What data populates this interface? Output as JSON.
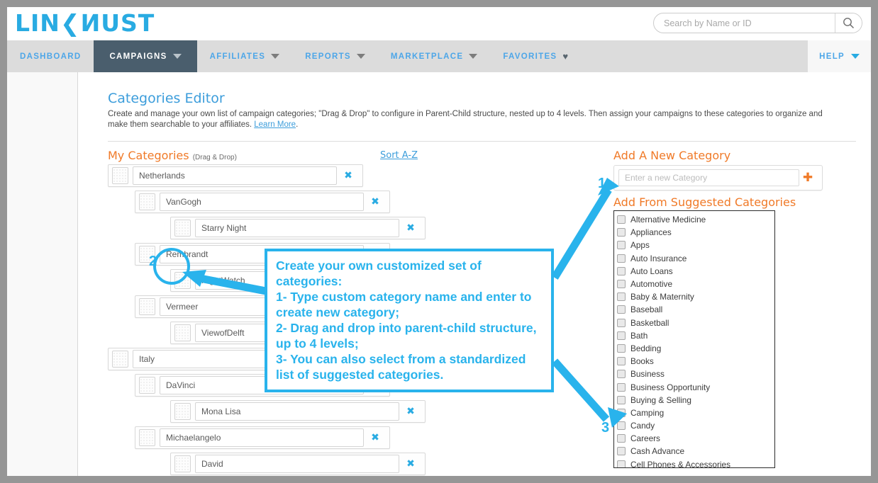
{
  "brand": {
    "logo_part1": "LIN",
    "logo_k": "❮",
    "logo_part2": "ИUSТ",
    "logo_text": "LINKTRUST"
  },
  "search": {
    "placeholder": "Search by Name or ID",
    "value": "",
    "icon": "search-icon"
  },
  "nav": {
    "items": [
      {
        "label": "DASHBOARD",
        "has_caret": false,
        "active": false
      },
      {
        "label": "CAMPAIGNS",
        "has_caret": true,
        "active": true
      },
      {
        "label": "AFFILIATES",
        "has_caret": true,
        "active": false
      },
      {
        "label": "REPORTS",
        "has_caret": true,
        "active": false
      },
      {
        "label": "MARKETPLACE",
        "has_caret": true,
        "active": false
      },
      {
        "label": "FAVORITES",
        "has_caret": false,
        "active": false,
        "icon": "heart-icon"
      }
    ],
    "help_label": "HELP"
  },
  "page": {
    "title": "Categories Editor",
    "description_before_link": "Create and manage your own list of campaign categories; \"Drag & Drop\" to configure in Parent-Child structure, nested up to 4 levels. Then assign your campaigns to these categories to organize and make them searchable to your affiliates. ",
    "link_text": "Learn More",
    "description_after_link": "."
  },
  "my_categories": {
    "heading": "My Categories",
    "heading_hint": "(Drag & Drop)",
    "sort_link": "Sort A-Z",
    "items": [
      {
        "name": "Netherlands",
        "level": 0
      },
      {
        "name": "VanGogh",
        "level": 1
      },
      {
        "name": "Starry Night",
        "level": 2
      },
      {
        "name": "Rembrandt",
        "level": 1
      },
      {
        "name": "NightWatch",
        "level": 2
      },
      {
        "name": "Vermeer",
        "level": 1
      },
      {
        "name": "ViewofDelft",
        "level": 2
      },
      {
        "name": "Italy",
        "level": 0
      },
      {
        "name": "DaVinci",
        "level": 1
      },
      {
        "name": "Mona Lisa",
        "level": 2
      },
      {
        "name": "Michaelangelo",
        "level": 1
      },
      {
        "name": "David",
        "level": 2
      }
    ],
    "remove_symbol": "✖"
  },
  "add_new_category": {
    "heading": "Add A New Category",
    "placeholder": "Enter a new Category",
    "value": "",
    "add_symbol": "✚"
  },
  "suggested": {
    "heading": "Add From Suggested Categories",
    "items": [
      "Alternative Medicine",
      "Appliances",
      "Apps",
      "Auto Insurance",
      "Auto Loans",
      "Automotive",
      "Baby & Maternity",
      "Baseball",
      "Basketball",
      "Bath",
      "Bedding",
      "Books",
      "Business",
      "Business Opportunity",
      "Buying & Selling",
      "Camping",
      "Candy",
      "Careers",
      "Cash Advance",
      "Cell Phones & Accessories"
    ]
  },
  "annotations": {
    "callout_lines": [
      "Create your own customized set of categories:",
      "1- Type custom category name and enter to create new category;",
      "2- Drag and drop into parent-child structure, up to 4 levels;",
      "3- You can also select from a standardized list of suggested categories."
    ],
    "markers": [
      {
        "id": "1",
        "label": "1"
      },
      {
        "id": "2",
        "label": "2"
      },
      {
        "id": "3",
        "label": "3"
      }
    ]
  },
  "colors": {
    "brand_blue": "#29abe2",
    "accent_orange": "#f07a28",
    "nav_active": "#4a5e6d",
    "nav_bg": "#dcdcdc",
    "annotation_blue": "#29b3ec",
    "link_blue": "#3c9ddb",
    "page_bg": "#969696"
  }
}
